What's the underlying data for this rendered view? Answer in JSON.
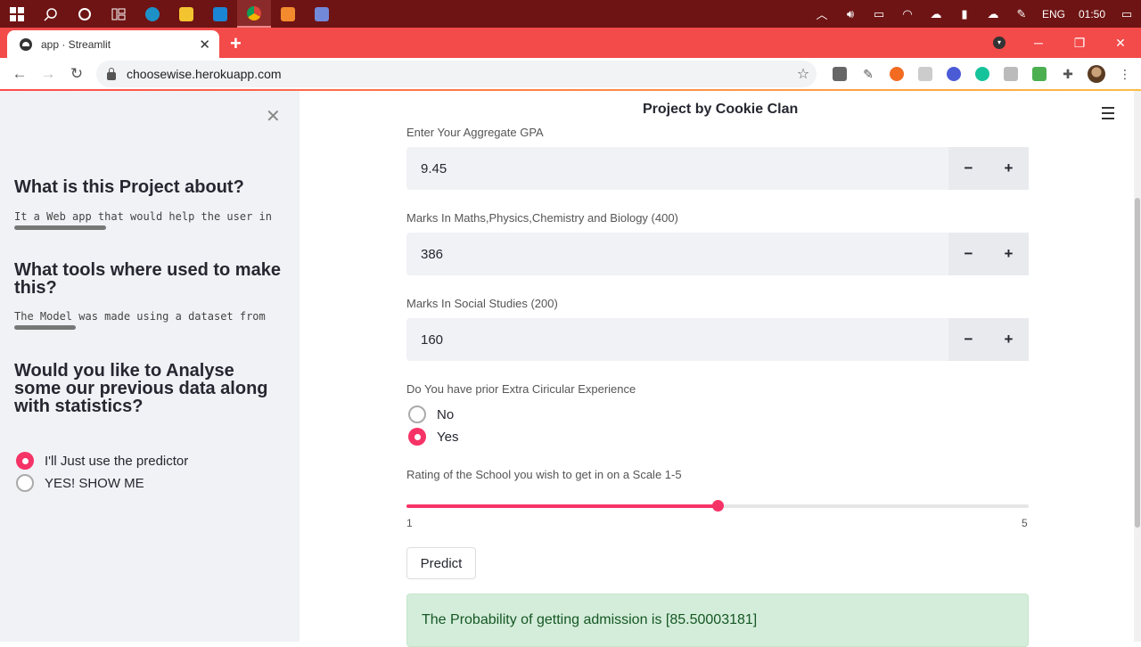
{
  "taskbar": {
    "apps": [
      "windows-start-icon",
      "search-icon",
      "cortana-icon",
      "task-view-icon",
      "edge-icon",
      "file-explorer-icon",
      "vscode-icon",
      "chrome-icon",
      "sublime-icon",
      "discord-icon"
    ],
    "tray": {
      "language": "ENG",
      "time": "01:50"
    }
  },
  "browser": {
    "tab_title": "app · Streamlit",
    "url": "choosewise.herokuapp.com",
    "colors": {
      "tabstrip": "#f34a4a",
      "taskbar": "#6e1414"
    }
  },
  "sidebar": {
    "sections": [
      {
        "heading": "What is this Project about?",
        "code": "It a Web app that would help the user in"
      },
      {
        "heading": "What tools where used to make this?",
        "code": "The Model was made using a dataset from"
      },
      {
        "heading": "Would you like to Analyse some our previous data along with statistics?"
      }
    ],
    "options": [
      {
        "label": "I'll Just use the predictor",
        "selected": true
      },
      {
        "label": "YES! SHOW ME",
        "selected": false
      }
    ]
  },
  "main": {
    "title": "Project by Cookie Clan",
    "gpa": {
      "label": "Enter Your Aggregate GPA",
      "value": "9.45"
    },
    "science": {
      "label": "Marks In Maths,Physics,Chemistry and Biology (400)",
      "value": "386"
    },
    "social": {
      "label": "Marks In Social Studies (200)",
      "value": "160"
    },
    "stepper": {
      "minus": "−",
      "plus": "+"
    },
    "extra": {
      "label": "Do You have prior Extra Ciricular Experience",
      "options": [
        {
          "label": "No",
          "selected": false
        },
        {
          "label": "Yes",
          "selected": true
        }
      ]
    },
    "rating": {
      "label": "Rating of the School you wish to get in on a Scale 1-5",
      "min": "1",
      "max": "5",
      "value": 3
    },
    "predict_label": "Predict",
    "result": "The Probability of getting admission is [85.50003181]",
    "accent": "#f63366"
  }
}
